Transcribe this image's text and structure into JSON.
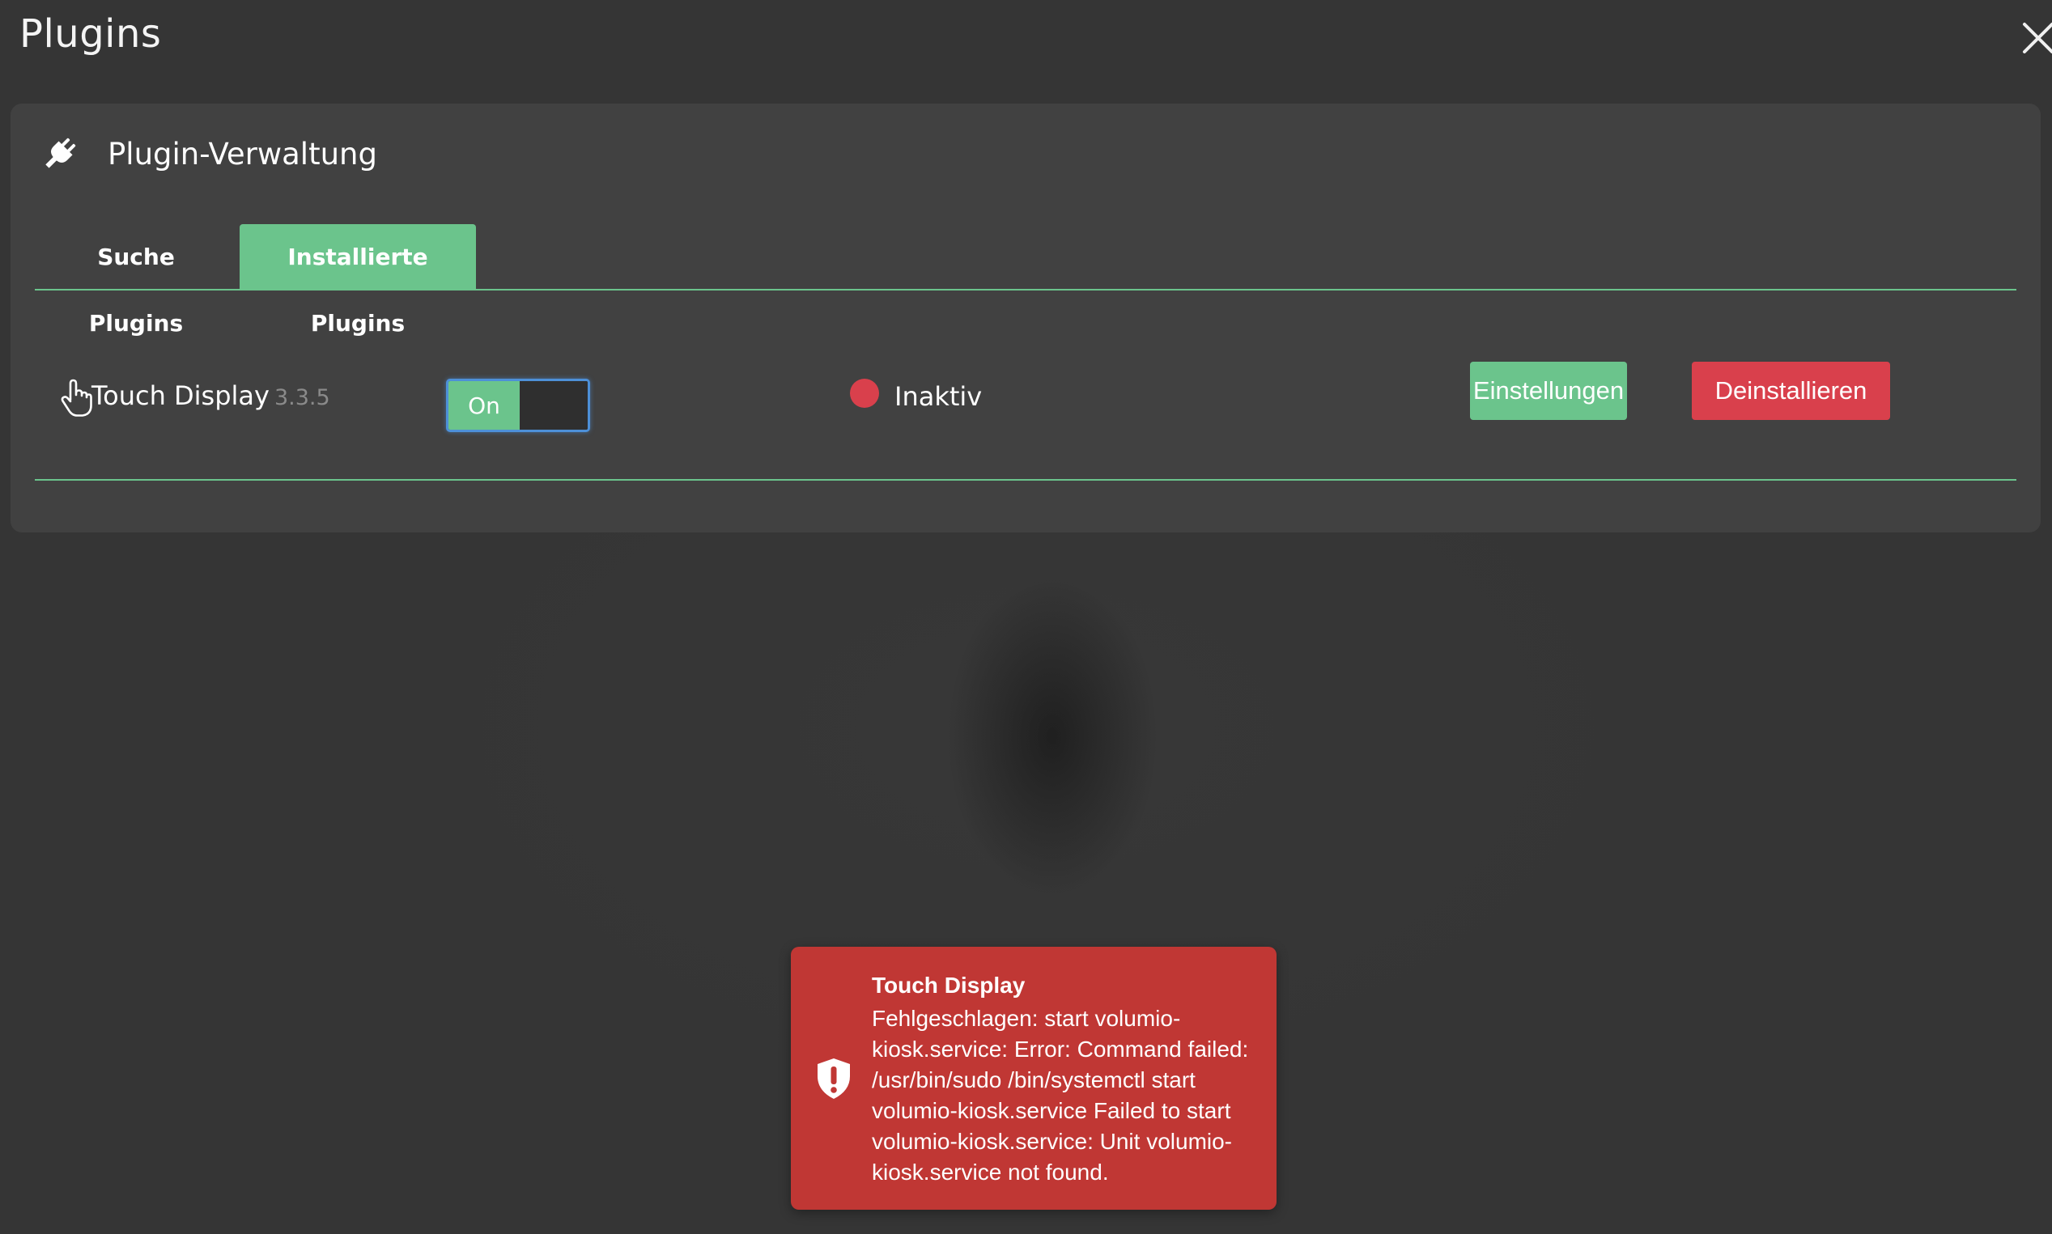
{
  "header": {
    "title": "Plugins",
    "close_icon": "close-icon"
  },
  "panel": {
    "icon": "plug-icon",
    "title": "Plugin-Verwaltung",
    "tabs": [
      {
        "label": "Suche Plugins",
        "active": false
      },
      {
        "label": "Installierte Plugins",
        "active": true
      }
    ]
  },
  "plugins": [
    {
      "icon": "hand-pointer-icon",
      "name": "Touch Display",
      "version": "3.3.5",
      "toggle_label": "On",
      "enabled": true,
      "status": "Inaktiv",
      "settings_label": "Einstellungen",
      "uninstall_label": "Deinstallieren"
    }
  ],
  "toast": {
    "icon": "shield-exclamation-icon",
    "title": "Touch Display",
    "message": "Fehlgeschlagen: start volumio-kiosk.service: Error: Command failed: /usr/bin/sudo /bin/systemctl start volumio-kiosk.service Failed to start volumio-kiosk.service: Unit volumio-kiosk.service not found."
  },
  "colors": {
    "background": "#353535",
    "panel": "#414141",
    "accent_green": "#6bc48c",
    "danger_red": "#d9404c",
    "toast_red": "#c03734",
    "focus_blue": "#4d90d8"
  }
}
